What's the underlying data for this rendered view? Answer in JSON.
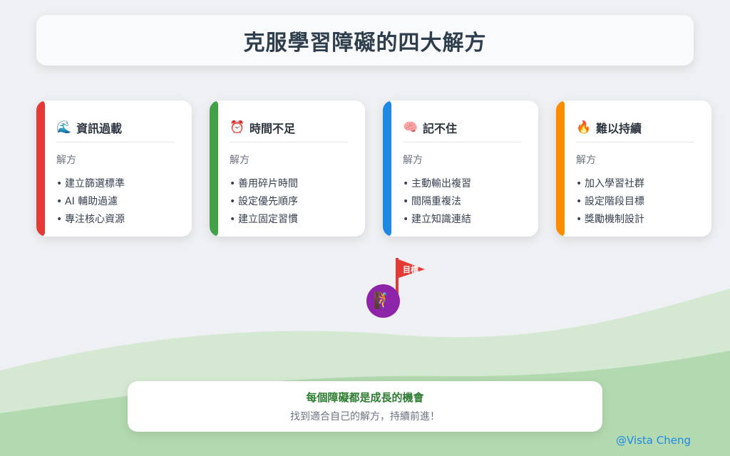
{
  "title": "克服學習障礙的四大解方",
  "cards": [
    {
      "icon": "wave-icon",
      "emoji": "🌊",
      "title": "資訊過載",
      "color": "#e53935",
      "label": "解方",
      "items": [
        "建立篩選標準",
        "AI 輔助過濾",
        "專注核心資源"
      ]
    },
    {
      "icon": "alarm-clock-icon",
      "emoji": "⏰",
      "title": "時間不足",
      "color": "#43a047",
      "label": "解方",
      "items": [
        "善用碎片時間",
        "設定優先順序",
        "建立固定習慣"
      ]
    },
    {
      "icon": "brain-icon",
      "emoji": "🧠",
      "title": "記不住",
      "color": "#1e88e5",
      "label": "解方",
      "items": [
        "主動輸出複習",
        "間隔重複法",
        "建立知識連結"
      ]
    },
    {
      "icon": "fire-icon",
      "emoji": "🔥",
      "title": "難以持續",
      "color": "#fb8c00",
      "label": "解方",
      "items": [
        "加入學習社群",
        "設定階段目標",
        "獎勵機制設計"
      ]
    }
  ],
  "goal": {
    "flag_text": "目標",
    "flag_color": "#e53935",
    "avatar_icon": "climber-icon",
    "avatar_emoji": "🧗",
    "avatar_color": "#8e24aa"
  },
  "footer": {
    "main": "每個障礙都是成長的機會",
    "sub": "找到適合自己的解方，持續前進！"
  },
  "credit": "@Vista Cheng"
}
